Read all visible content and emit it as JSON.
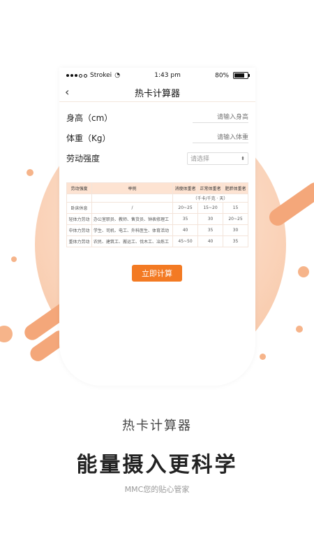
{
  "status_bar": {
    "carrier": "Strokei",
    "time": "1:43 pm",
    "battery": "80%"
  },
  "nav": {
    "title": "热卡计算器"
  },
  "form": {
    "height_label": "身高（cm）",
    "height_placeholder": "请输入身高",
    "weight_label": "体重（Kg）",
    "weight_placeholder": "请输入体重",
    "labor_label": "劳动强度",
    "labor_select": "请选择"
  },
  "table": {
    "headers": [
      "劳动强度",
      "举例",
      "消瘦体重者",
      "正常体重者",
      "肥胖体重者"
    ],
    "unit": "（千卡/千克 · 天）",
    "rows": [
      {
        "level": "卧床休息",
        "example": "/",
        "thin": "20~25",
        "normal": "15~20",
        "obese": "15"
      },
      {
        "level": "轻体力劳动",
        "example": "办公室职员、教师、售货员、钟表修理工",
        "thin": "35",
        "normal": "30",
        "obese": "20~25"
      },
      {
        "level": "中体力劳动",
        "example": "学生、司机、电工、外科医生、体育活动",
        "thin": "40",
        "normal": "35",
        "obese": "30"
      },
      {
        "level": "重体力劳动",
        "example": "农民、建筑工、搬运工、伐木工、冶炼工",
        "thin": "45~50",
        "normal": "40",
        "obese": "35"
      }
    ]
  },
  "calculate_button": "立即计算",
  "captions": {
    "line1": "热卡计算器",
    "line2": "能量摄入更科学",
    "line3": "MMC您的贴心管家"
  },
  "colors": {
    "accent": "#f37a23",
    "table_header": "#fde3d2",
    "decor": "#f6b48a"
  }
}
